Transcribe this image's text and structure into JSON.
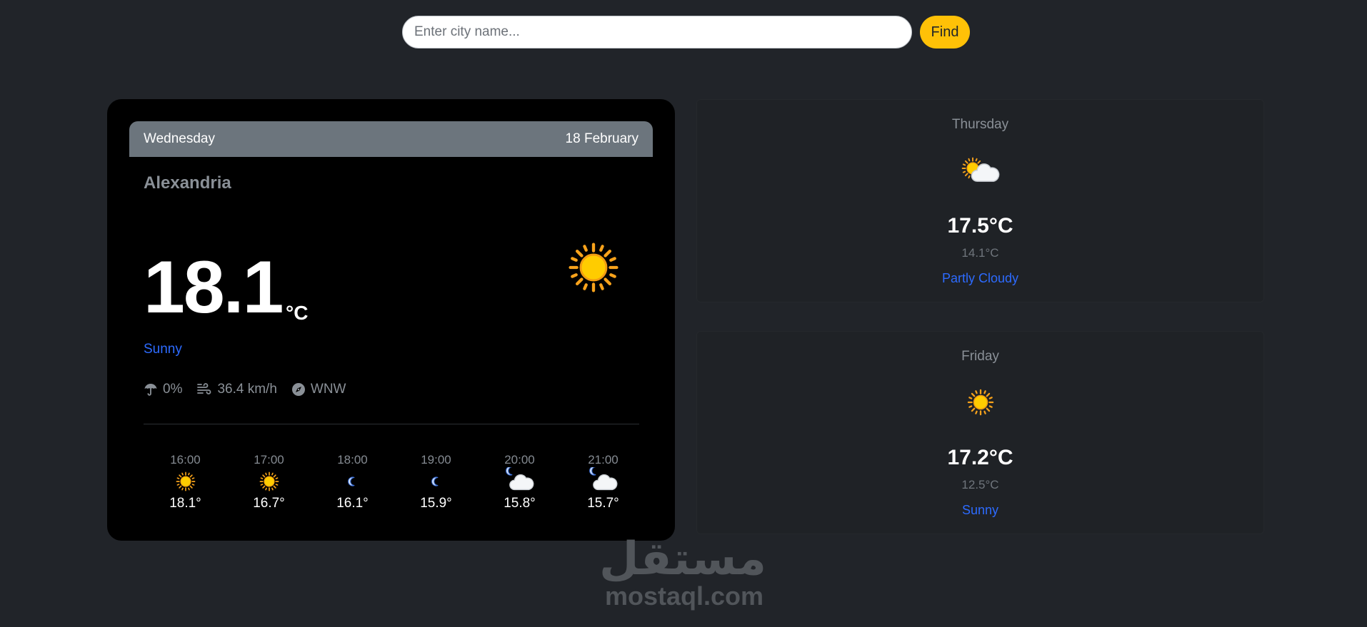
{
  "search": {
    "placeholder": "Enter city name...",
    "button_label": "Find"
  },
  "today": {
    "day": "Wednesday",
    "date": "18 February",
    "city": "Alexandria",
    "temp": "18.1",
    "unit": "°C",
    "condition": "Sunny",
    "icon": "sun-icon",
    "rain": "0%",
    "wind": "36.4 km/h",
    "direction": "WNW"
  },
  "hourly": [
    {
      "time": "16:00",
      "icon": "sun-icon",
      "temp": "18.1°"
    },
    {
      "time": "17:00",
      "icon": "sun-icon",
      "temp": "16.7°"
    },
    {
      "time": "18:00",
      "icon": "moon-icon",
      "temp": "16.1°"
    },
    {
      "time": "19:00",
      "icon": "moon-icon",
      "temp": "15.9°"
    },
    {
      "time": "20:00",
      "icon": "moon-cloud-icon",
      "temp": "15.8°"
    },
    {
      "time": "21:00",
      "icon": "moon-cloud-icon",
      "temp": "15.7°"
    }
  ],
  "forecast": [
    {
      "day": "Thursday",
      "icon": "sun-cloud-icon",
      "max": "17.5°C",
      "min": "14.1°C",
      "condition": "Partly Cloudy"
    },
    {
      "day": "Friday",
      "icon": "sun-icon",
      "max": "17.2°C",
      "min": "12.5°C",
      "condition": "Sunny"
    }
  ],
  "watermark": {
    "arabic": "مستقل",
    "latin": "mostaql.com"
  },
  "colors": {
    "background": "#212429",
    "accent": "#ffc107",
    "condition_link": "#2d6bff"
  }
}
